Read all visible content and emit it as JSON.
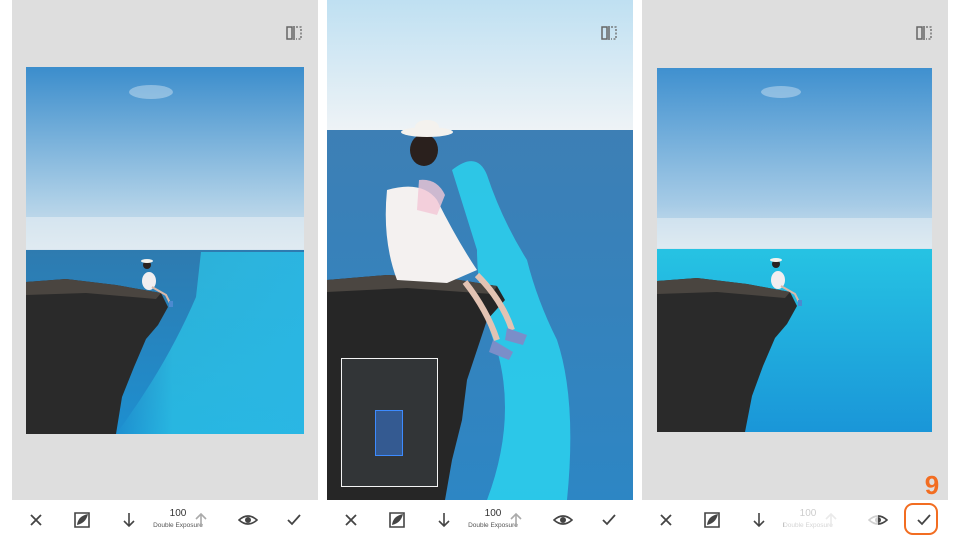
{
  "panels": [
    {
      "id": "before",
      "toolbar": {
        "cancel_icon": "close-icon",
        "mask_icon": "brush-mask-icon",
        "down_icon": "arrow-down-icon",
        "opacity_value": "100",
        "effect_label": "Double Exposure",
        "up_icon": "arrow-up-icon",
        "view_icon": "eye-icon",
        "apply_icon": "checkmark-icon"
      }
    },
    {
      "id": "zoomed",
      "toolbar": {
        "cancel_icon": "close-icon",
        "mask_icon": "brush-mask-icon",
        "down_icon": "arrow-down-icon",
        "opacity_value": "100",
        "effect_label": "Double Exposure",
        "up_icon": "arrow-up-icon",
        "view_icon": "eye-icon",
        "apply_icon": "checkmark-icon"
      }
    },
    {
      "id": "after",
      "toolbar": {
        "cancel_icon": "close-icon",
        "mask_icon": "brush-mask-icon",
        "down_icon": "arrow-down-icon",
        "opacity_value": "100",
        "effect_label": "Double Exposure",
        "up_icon": "arrow-up-icon",
        "view_icon": "eye-icon",
        "apply_icon": "checkmark-icon"
      }
    }
  ],
  "step_number": "9",
  "colors": {
    "accent": "#f26d21",
    "sky_top": "#3f8fcf",
    "sea": "#2aa8d8",
    "cliff": "#2b2b2b",
    "panel_bg": "#dedede"
  }
}
